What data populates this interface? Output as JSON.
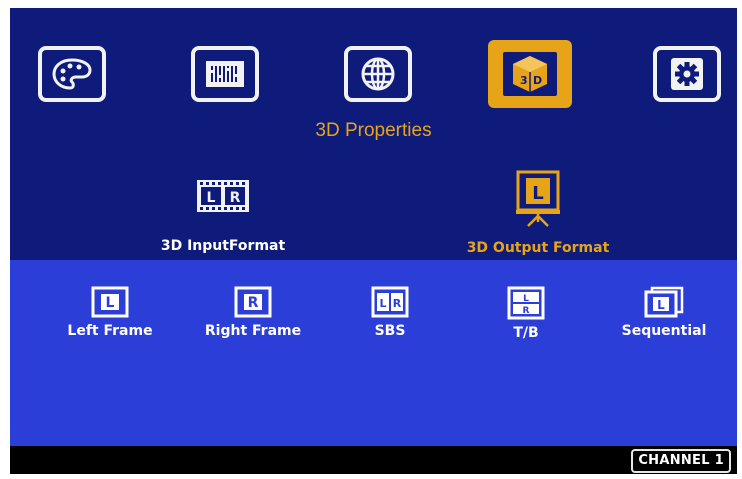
{
  "menu": {
    "items": [
      {
        "icon": "palette-icon",
        "active": false
      },
      {
        "icon": "equalizer-icon",
        "active": false
      },
      {
        "icon": "globe-icon",
        "active": false
      },
      {
        "icon": "3d-cube-icon",
        "active": true
      },
      {
        "icon": "gear-icon",
        "active": false
      }
    ],
    "section_title": "3D Properties"
  },
  "submenu": {
    "input_format_label": "3D InputFormat",
    "output_format_label": "3D Output Format",
    "input_icon_letters": [
      "L",
      "R"
    ],
    "output_icon_letter": "L"
  },
  "formats": [
    {
      "label": "Left Frame",
      "icon": "left-frame-icon",
      "letters": "L"
    },
    {
      "label": "Right Frame",
      "icon": "right-frame-icon",
      "letters": "R"
    },
    {
      "label": "SBS",
      "icon": "side-by-side-icon",
      "letters": "LR"
    },
    {
      "label": "T/B",
      "icon": "top-bottom-icon",
      "letters": "LR"
    },
    {
      "label": "Sequential",
      "icon": "sequential-icon",
      "letters": "L"
    }
  ],
  "status": {
    "channel": "CHANNEL 1"
  },
  "colors": {
    "top_background": "#0e1b7a",
    "bottom_background": "#2b3fd8",
    "accent": "#e8a418",
    "text": "#ffffff"
  }
}
